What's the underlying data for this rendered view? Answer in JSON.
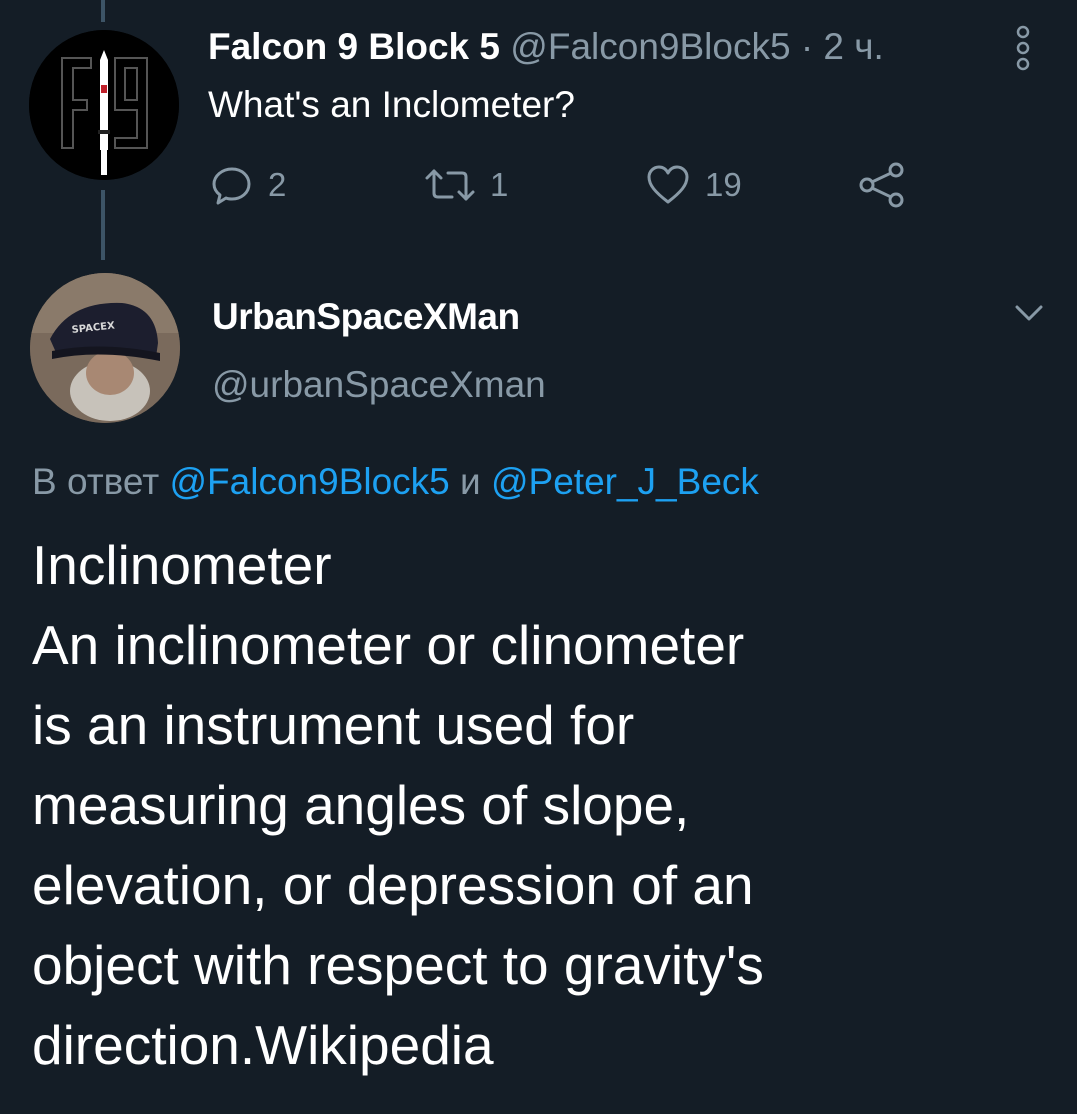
{
  "tweet1": {
    "name": "Falcon 9 Block 5",
    "handle": "@Falcon9Block5",
    "separator": "·",
    "time": "2 ч.",
    "text": "What's an Inclometer?",
    "replies": "2",
    "retweets": "1",
    "likes": "19"
  },
  "tweet2": {
    "name": "UrbanSpaceXMan",
    "handle": "@urbanSpaceXman",
    "reply_prefix": "В ответ",
    "reply_mention1": "@Falcon9Block5",
    "reply_and": "и",
    "reply_mention2": "@Peter_J_Beck",
    "avatar_cap_text": "SPACEX",
    "lines": [
      "Inclinometer",
      "An inclinometer or clinometer",
      "is an instrument used for",
      "measuring angles of slope,",
      "elevation, or depression of an",
      "object with respect to gravity's",
      "direction.Wikipedia"
    ]
  },
  "colors": {
    "background": "#141d26",
    "secondary_text": "#8899a6",
    "link": "#1da1f2",
    "thread_line": "#3d5466"
  },
  "icons": [
    "reply-icon",
    "retweet-icon",
    "like-icon",
    "share-icon",
    "more-icon",
    "chevron-down-icon"
  ]
}
